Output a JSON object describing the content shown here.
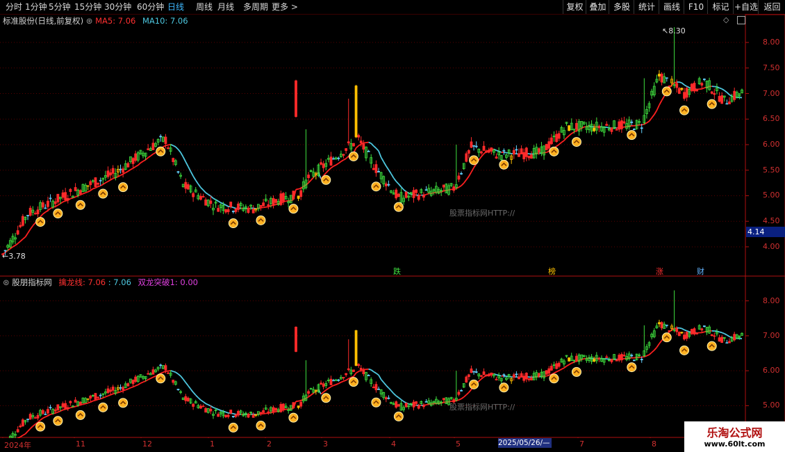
{
  "toolbar": {
    "periods": [
      "分时",
      "1分钟",
      "5分钟",
      "15分钟",
      "30分钟",
      "60分钟",
      "日线",
      "周线",
      "月线",
      "多周期",
      "更多 >"
    ],
    "active_period": "日线",
    "right_buttons": [
      "复权",
      "叠加",
      "多股",
      "统计",
      "画线",
      "F10",
      "标记",
      "+自选",
      "返回"
    ]
  },
  "main_panel": {
    "title": "标准股份(日线,前复权)",
    "ma5_label": "MA5: 7.06",
    "ma10_label": "MA10: 7.06",
    "high_marker": "8.30",
    "low_marker": "3.78",
    "cursor_value": "4.14",
    "watermark": "股票指标网HTTP://",
    "y_ticks": [
      "8.00",
      "7.50",
      "7.00",
      "6.50",
      "6.00",
      "5.50",
      "5.00",
      "4.50",
      "4.00"
    ],
    "event_tags": [
      "跌",
      "榜",
      "涨",
      "财"
    ]
  },
  "sub_panel": {
    "title": "股朋指标网",
    "line1_label": "擒龙线: 7.06",
    "line2_label": ": 7.06",
    "line3_label": "双龙突破1: 0.00",
    "watermark": "股票指标网HTTP://",
    "y_ticks": [
      "8.00",
      "7.00",
      "6.00",
      "5.00"
    ]
  },
  "date_axis": {
    "labels": [
      "2024年",
      "11",
      "12",
      "1",
      "2",
      "3",
      "4",
      "5",
      "7",
      "8"
    ],
    "cursor_date": "2025/05/26/—"
  },
  "brand": {
    "name": "乐淘公式网",
    "url": "www.60lt.com"
  },
  "colors": {
    "up": "#ff2a2a",
    "down": "#3fe03f",
    "flat": "#64d2ff",
    "limit": "#ffc000",
    "ma_up": "#ff2020",
    "ma_down": "#4ec8e0",
    "signal_fill": "#ffb020",
    "grid": "#5a0000"
  }
}
